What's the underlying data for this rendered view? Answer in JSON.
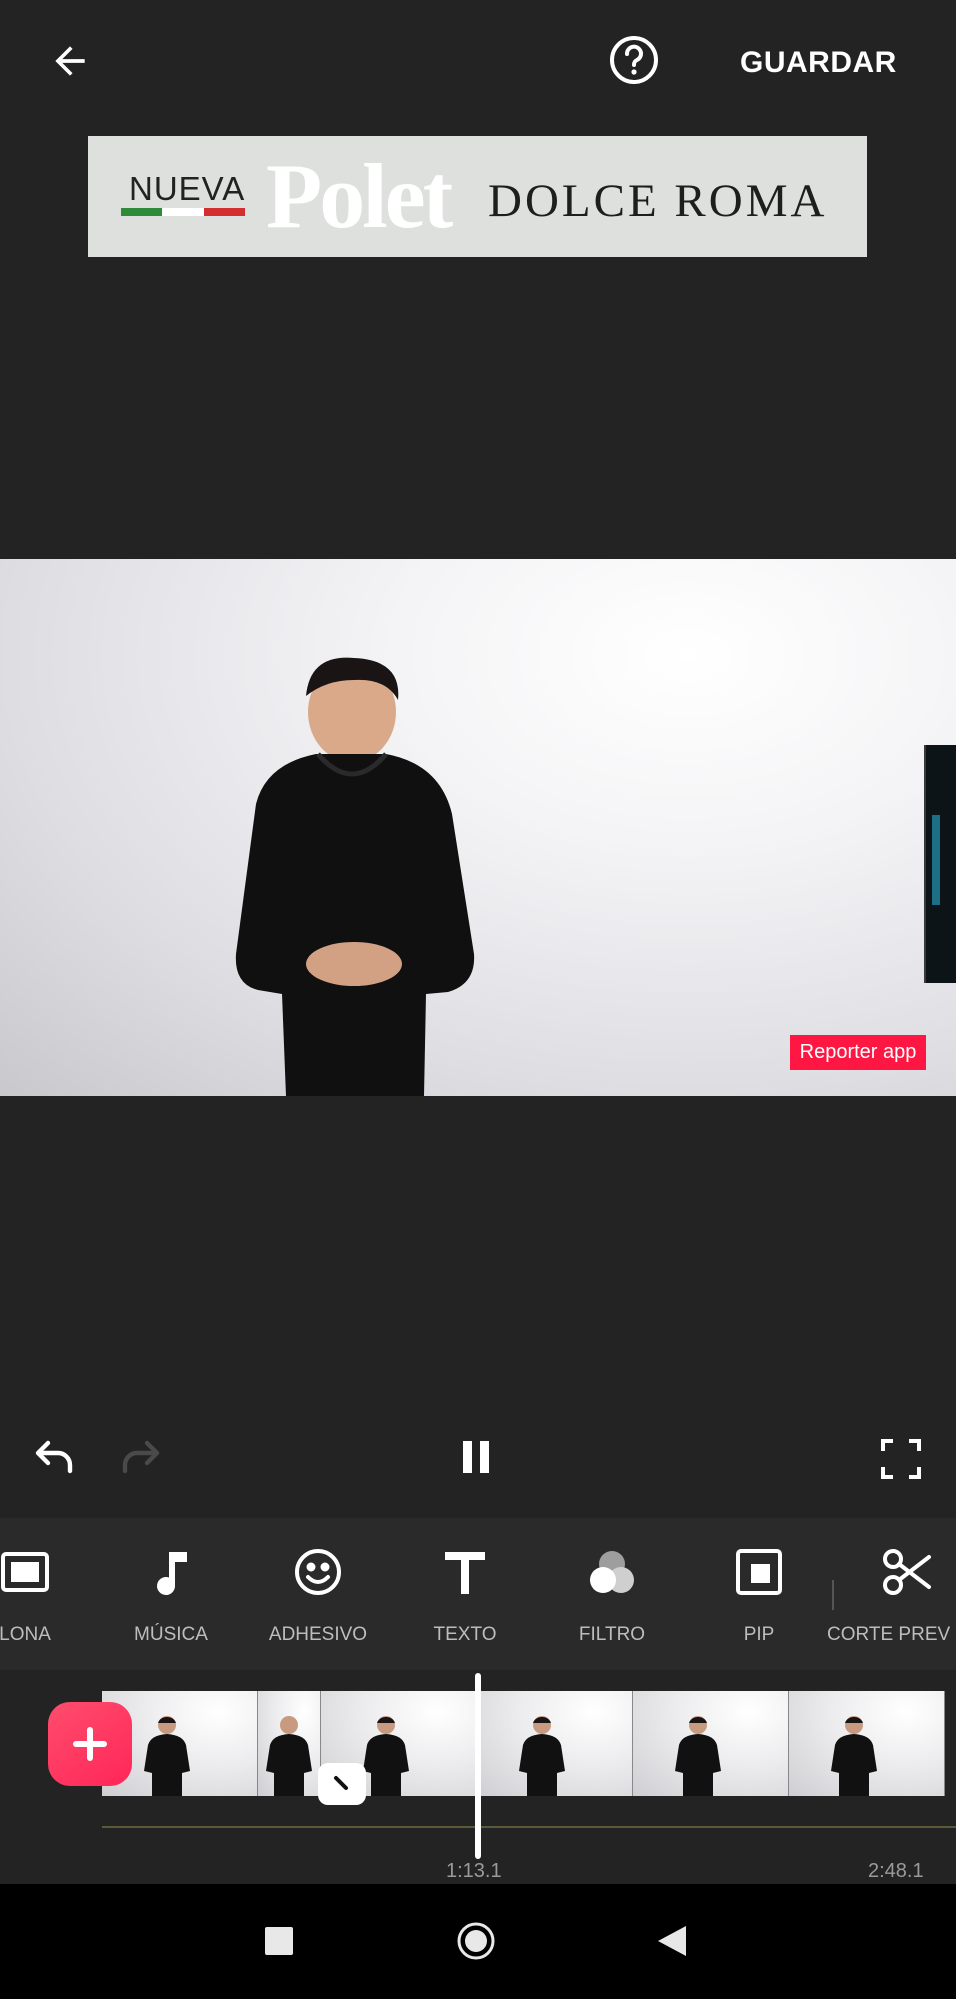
{
  "header": {
    "back_icon": "arrow-left-icon",
    "help_icon": "question-circle-icon",
    "save_label": "GUARDAR"
  },
  "banner": {
    "nueva": "NUEVA",
    "brand": "Polet",
    "product": "DOLCE ROMA",
    "flag_colors": [
      "#2e8b3a",
      "#ffffff",
      "#d32f2f"
    ]
  },
  "video": {
    "watermark": "Reporter app"
  },
  "playback": {
    "undo_icon": "undo-icon",
    "redo_icon": "redo-icon",
    "pause_icon": "pause-icon",
    "fullscreen_icon": "fullscreen-icon"
  },
  "toolbar": {
    "items": [
      {
        "label": "LONA",
        "icon": "canvas-icon"
      },
      {
        "label": "MÚSICA",
        "icon": "music-note-icon"
      },
      {
        "label": "ADHESIVO",
        "icon": "smiley-icon"
      },
      {
        "label": "TEXTO",
        "icon": "text-icon"
      },
      {
        "label": "FILTRO",
        "icon": "filter-icon"
      },
      {
        "label": "PIP",
        "icon": "pip-icon"
      },
      {
        "label": "CORTE PREV",
        "icon": "scissors-icon"
      }
    ]
  },
  "timeline": {
    "add_icon": "plus-icon",
    "current_time": "1:13.1",
    "total_time": "2:48.1",
    "thumbnail_count": 6
  },
  "colors": {
    "accent": "#ff2658",
    "background": "#232323",
    "toolbar_bg": "#2a2a2a",
    "watermark_bg": "#ff1744"
  }
}
